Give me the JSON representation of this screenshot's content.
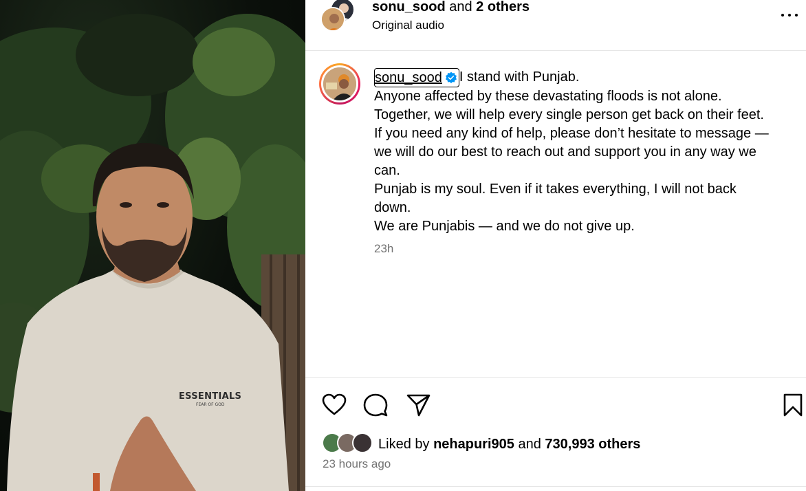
{
  "header": {
    "username": "sonu_sood",
    "and_text": "and",
    "others": "2 others",
    "subtitle": "Original audio",
    "more_icon": "more-horizontal-icon"
  },
  "caption": {
    "username": "sonu_sood",
    "verified_icon": "verified-badge-icon",
    "lines": [
      "I stand with Punjab.",
      "Anyone affected by these devastating floods is not alone.",
      "Together, we will help every single person get back on their feet.",
      "If you need any kind of help, please don’t hesitate to message —",
      "we will do our best to reach out and support you in any way we",
      "can.",
      "Punjab is my soul. Even if it takes everything, I will not back",
      "down.",
      "We are Punjabis — and we do not give up."
    ],
    "time": "23h"
  },
  "actions": {
    "like_icon": "heart-icon",
    "comment_icon": "comment-icon",
    "share_icon": "share-icon",
    "save_icon": "bookmark-icon"
  },
  "likes": {
    "prefix": "Liked by",
    "user": "nehapuri905",
    "and_text": "and",
    "others": "730,993 others"
  },
  "timestamp": "23 hours ago",
  "media": {
    "shirt_text": "ESSENTIALS",
    "shirt_subtext": "FEAR OF GOD"
  }
}
